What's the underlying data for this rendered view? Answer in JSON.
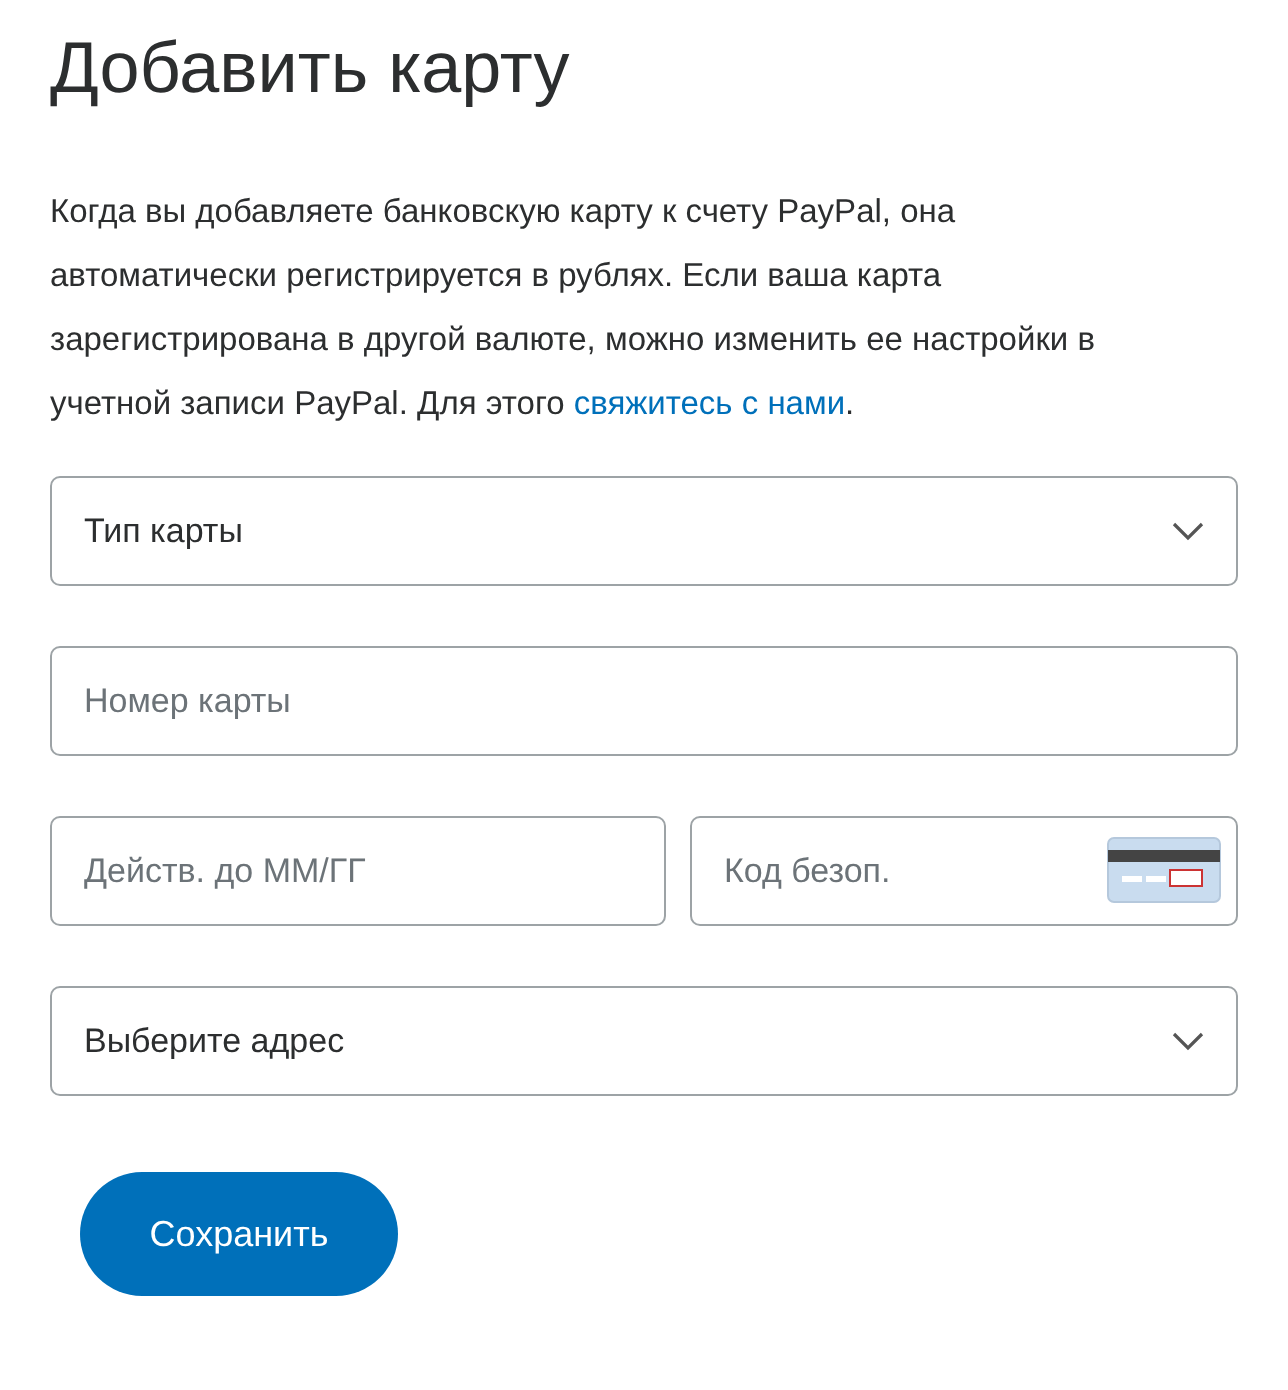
{
  "title": "Добавить карту",
  "intro": {
    "text": "Когда вы добавляете банковскую карту к счету PayPal, она автоматически регистрируется в рублях. Если ваша карта зарегистрирована в другой валюте, можно изменить ее настройки в учетной записи PayPal. Для этого ",
    "link": "свяжитесь с нами",
    "end": "."
  },
  "fields": [
    {
      "kind": "select",
      "label": "Тип карты"
    },
    {
      "kind": "input",
      "placeholder": "Номер карты"
    },
    {
      "kind": "pair",
      "items": [
        {
          "kind": "input",
          "placeholder": "Действ. до ММ/ГГ"
        },
        {
          "kind": "cvv",
          "placeholder": "Код безоп."
        }
      ]
    },
    {
      "kind": "select",
      "label": "Выберите адрес"
    }
  ],
  "button": "Сохранить"
}
